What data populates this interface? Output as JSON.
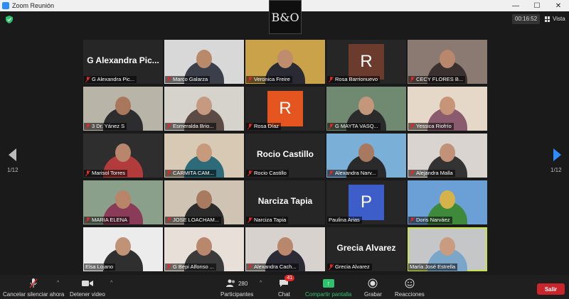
{
  "window": {
    "title": "Zoom Reunión",
    "minimize": "—",
    "maximize": "☐",
    "close": "✕"
  },
  "header": {
    "logo_text": "B&O",
    "timer": "00:16:52",
    "view_label": "Vista"
  },
  "pager": {
    "left": "1/12",
    "right": "1/12"
  },
  "participants": [
    {
      "name": "G Alexandra Pic...",
      "kind": "name",
      "muted": true
    },
    {
      "name": "Marco Galarza",
      "kind": "video",
      "bg": "#d8d8d8",
      "body": "#3a3f4a",
      "skin": "#b98a6a",
      "muted": true
    },
    {
      "name": "Veronica Freire",
      "kind": "video",
      "bg": "#c9a24a",
      "body": "#2a2a35",
      "skin": "#c08c6e",
      "muted": true
    },
    {
      "name": "Rosa Barrionuevo",
      "kind": "avatar",
      "letter": "R",
      "color": "#6b3b2e",
      "muted": true
    },
    {
      "name": "CECY FLORES B...",
      "kind": "video",
      "bg": "#8a7a72",
      "body": "#3b3030",
      "skin": "#b8876c",
      "muted": true
    },
    {
      "name": "3 Dr. Yánez S",
      "kind": "video",
      "bg": "#b9b4a8",
      "body": "#2d2d30",
      "skin": "#a9785c",
      "muted": true
    },
    {
      "name": "Esmeralda Brio...",
      "kind": "video",
      "bg": "#d6d2cc",
      "body": "#5c4a45",
      "skin": "#c59a80",
      "muted": true
    },
    {
      "name": "Rosa Díaz",
      "kind": "avatar",
      "letter": "R",
      "color": "#e5551f",
      "muted": true
    },
    {
      "name": "G MAYTA VASQ...",
      "kind": "video",
      "bg": "#6f8a70",
      "body": "#2b2b2b",
      "skin": "#c4967a",
      "muted": true
    },
    {
      "name": "Yessica Riofrío",
      "kind": "video",
      "bg": "#e6d8c8",
      "body": "#8a5b6e",
      "skin": "#c79478",
      "muted": true
    },
    {
      "name": "Marisol Torres",
      "kind": "video",
      "bg": "#2e2e2e",
      "body": "#b23b3b",
      "skin": "#b7866c",
      "muted": true
    },
    {
      "name": "CARMITA CAM...",
      "kind": "video",
      "bg": "#d8c9b4",
      "body": "#2d6b7a",
      "skin": "#c89a7c",
      "muted": true
    },
    {
      "name": "Rocio Castillo",
      "kind": "name",
      "muted": true
    },
    {
      "name": "Alexandra Narv...",
      "kind": "video",
      "bg": "#7ab0d8",
      "body": "#2a2a2a",
      "skin": "#a8795e",
      "muted": true
    },
    {
      "name": "Alejandra Malla",
      "kind": "video",
      "bg": "#d9d4d0",
      "body": "#333",
      "skin": "#c29278",
      "muted": true
    },
    {
      "name": "MARIA ELENA",
      "kind": "video",
      "bg": "#8aa08a",
      "body": "#8a3b57",
      "skin": "#b88568",
      "muted": true
    },
    {
      "name": "JOSE LOACHAM...",
      "kind": "video",
      "bg": "#cfc3b4",
      "body": "#2b2b2b",
      "skin": "#a87a5f",
      "muted": true
    },
    {
      "name": "Narciza Tapia",
      "kind": "name",
      "muted": true
    },
    {
      "name": "Paulina Arias",
      "kind": "avatar",
      "letter": "P",
      "color": "#3d5ec9",
      "muted": false
    },
    {
      "name": "Doris Narváez",
      "kind": "video",
      "bg": "#6aa0d6",
      "body": "#3f8a3a",
      "skin": "#d6b34a",
      "muted": true
    },
    {
      "name": "Elsa Lojano",
      "kind": "video",
      "bg": "#ececec",
      "body": "#2f2f2f",
      "skin": "#c09276",
      "muted": false
    },
    {
      "name": "G Bepi Alfonso ...",
      "kind": "video",
      "bg": "#e8e0d8",
      "body": "#3a3a3a",
      "skin": "#b9886c",
      "muted": true
    },
    {
      "name": "Alexandra Cach...",
      "kind": "video",
      "bg": "#d7d2cd",
      "body": "#2b2b35",
      "skin": "#b8876c",
      "muted": true
    },
    {
      "name": "Grecia Alvarez",
      "kind": "name",
      "muted": true
    },
    {
      "name": "María José Estrella",
      "kind": "video",
      "bg": "#c4c6c8",
      "body": "#7aa6c9",
      "skin": "#c99c80",
      "muted": false,
      "active": true
    }
  ],
  "toolbar": {
    "mute": "Cancelar silenciar ahora",
    "video": "Detener video",
    "participants": "Participantes",
    "participants_count": "280",
    "chat": "Chat",
    "chat_badge": "41",
    "share": "Compartir pantalla",
    "record": "Grabar",
    "reactions": "Reacciones",
    "leave": "Salir",
    "caret": "^"
  },
  "colors": {
    "accent": "#2d8cff",
    "share": "#2dc26b",
    "leave": "#c8262a",
    "active_speaker": "#c8e24a"
  }
}
